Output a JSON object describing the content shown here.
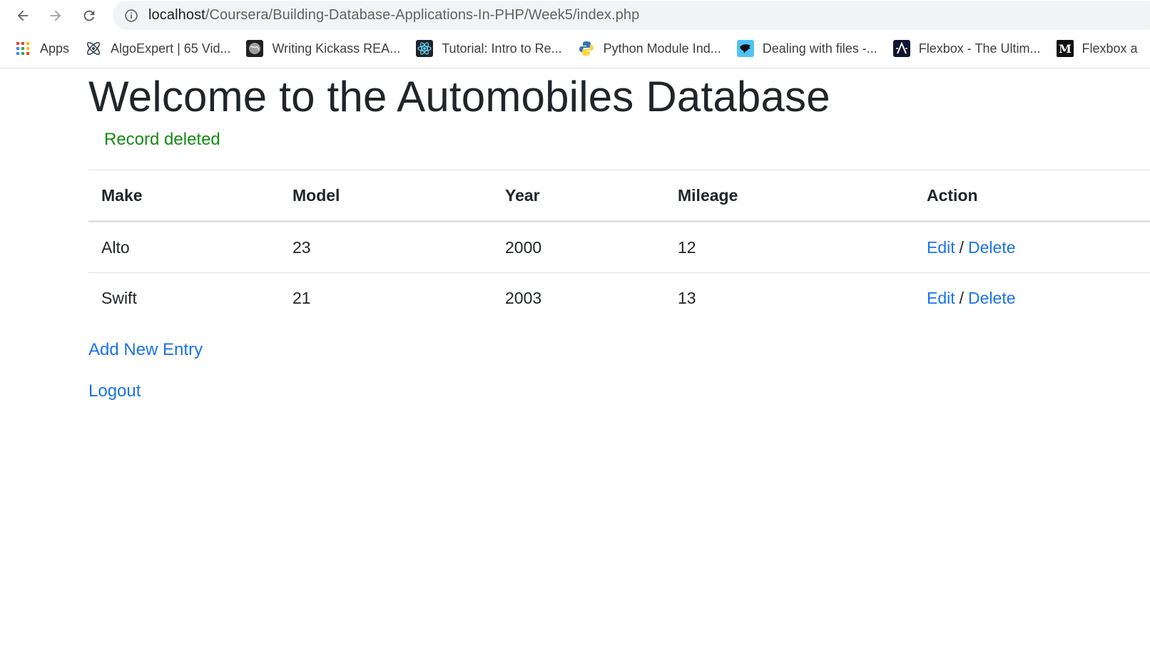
{
  "browser": {
    "url_host": "localhost",
    "url_path": "/Coursera/Building-Database-Applications-In-PHP/Week5/index.php",
    "bookmarks": [
      {
        "label": "Apps",
        "icon": "apps-grid-icon"
      },
      {
        "label": "AlgoExpert | 65 Vid...",
        "icon": "algoexpert-icon"
      },
      {
        "label": "Writing Kickass REA...",
        "icon": "globe-icon"
      },
      {
        "label": "Tutorial: Intro to Re...",
        "icon": "react-atom-icon"
      },
      {
        "label": "Python Module Ind...",
        "icon": "python-icon"
      },
      {
        "label": "Dealing with files -...",
        "icon": "panther-icon"
      },
      {
        "label": "Flexbox - The Ultim...",
        "icon": "flexbox-logo-icon"
      },
      {
        "label": "Flexbox a",
        "icon": "medium-m-icon"
      }
    ]
  },
  "page": {
    "title": "Welcome to the Automobiles Database",
    "flash_message": "Record deleted",
    "table": {
      "headers": [
        "Make",
        "Model",
        "Year",
        "Mileage",
        "Action"
      ],
      "rows": [
        {
          "make": "Alto",
          "model": "23",
          "year": "2000",
          "mileage": "12",
          "edit": "Edit",
          "sep": "/",
          "delete": "Delete"
        },
        {
          "make": "Swift",
          "model": "21",
          "year": "2003",
          "mileage": "13",
          "edit": "Edit",
          "sep": "/",
          "delete": "Delete"
        }
      ]
    },
    "add_new_label": "Add New Entry",
    "logout_label": "Logout"
  },
  "colors": {
    "link": "#1a73e8",
    "flash": "#138a13",
    "text": "#212529"
  }
}
